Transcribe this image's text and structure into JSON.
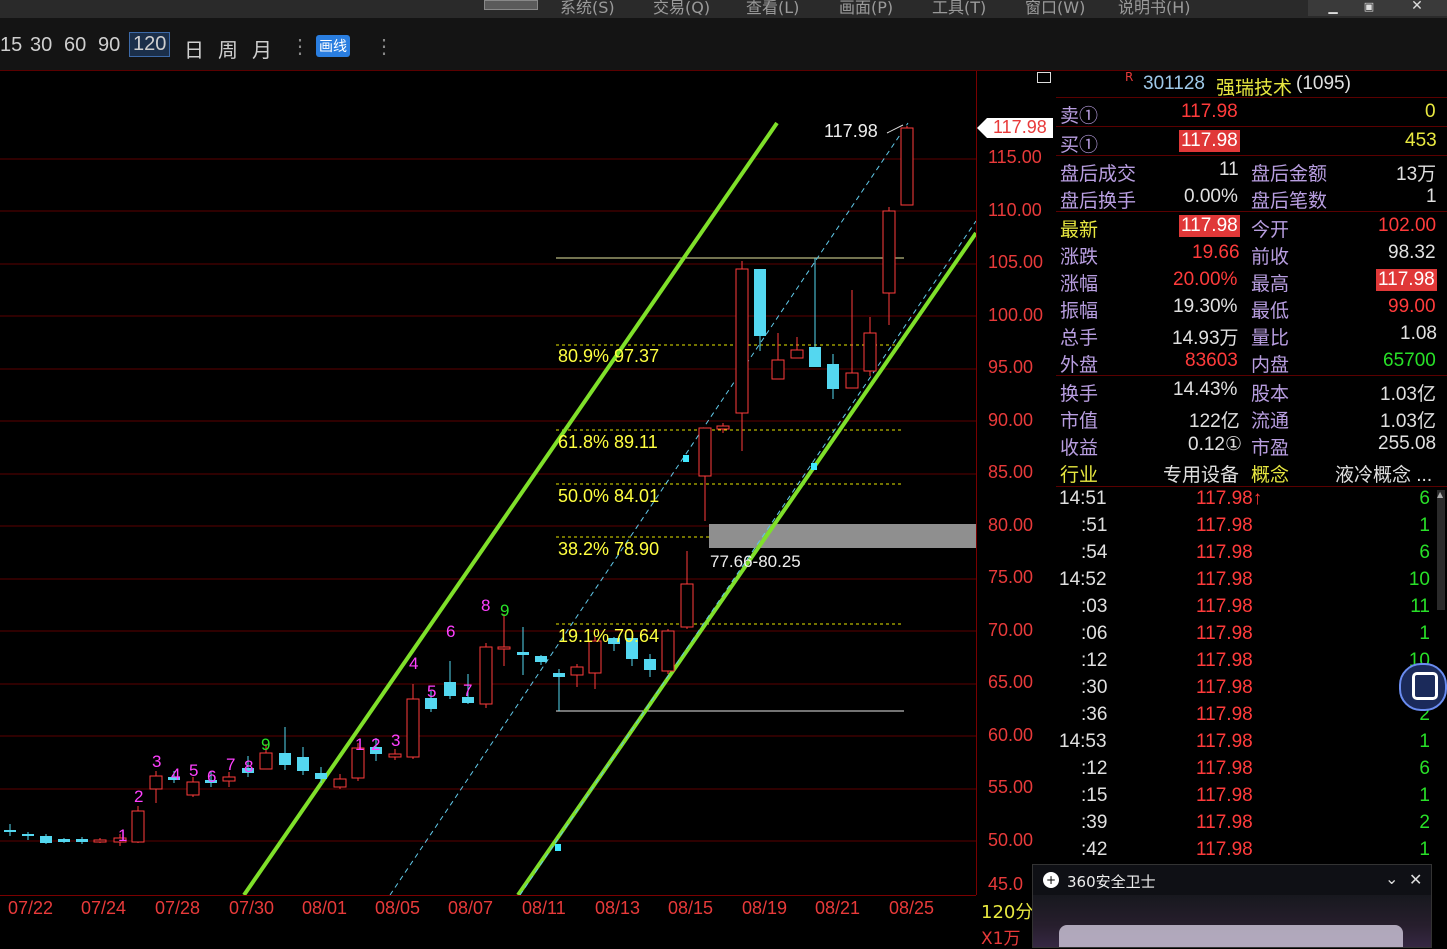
{
  "menu": [
    "系统(S)",
    "交易(Q)",
    "查看(L)",
    "画面(P)",
    "工具(T)",
    "窗口(W)",
    "说明书(H)"
  ],
  "toolbar": {
    "periods": [
      "15",
      "30",
      "60",
      "90"
    ],
    "selected_period": "120",
    "day": "日",
    "week": "周",
    "month": "月",
    "draw_button": "画线"
  },
  "chart": {
    "price_axis": [
      "115.00",
      "110.00",
      "105.00",
      "100.00",
      "95.00",
      "90.00",
      "85.00",
      "80.00",
      "75.00",
      "70.00",
      "65.00",
      "60.00",
      "55.00",
      "50.00",
      "45.0"
    ],
    "date_axis": [
      "07/22",
      "07/24",
      "07/28",
      "07/30",
      "08/01",
      "08/05",
      "08/07",
      "08/11",
      "08/13",
      "08/15",
      "08/19",
      "08/21",
      "08/25"
    ],
    "period_label": "120分",
    "volume_unit": "X1万",
    "last_price_tag": "117.98",
    "high_label": "117.98",
    "fib_levels": [
      {
        "label": "80.9% 97.37"
      },
      {
        "label": "61.8% 89.11"
      },
      {
        "label": "50.0% 84.01"
      },
      {
        "label": "38.2% 78.90"
      },
      {
        "label": "19.1% 70.64"
      }
    ],
    "zone_label": "77.66-80.25",
    "counts": [
      {
        "t": "1",
        "c": "#ff40ff"
      },
      {
        "t": "2",
        "c": "#ff40ff"
      },
      {
        "t": "3",
        "c": "#ff40ff"
      },
      {
        "t": "4",
        "c": "#ff40ff"
      },
      {
        "t": "5",
        "c": "#ff40ff"
      },
      {
        "t": "6",
        "c": "#ff40ff"
      },
      {
        "t": "7",
        "c": "#ff40ff"
      },
      {
        "t": "8",
        "c": "#ff40ff"
      },
      {
        "t": "9",
        "c": "#28e028"
      },
      {
        "t": "1",
        "c": "#ff40ff"
      },
      {
        "t": "2",
        "c": "#ff40ff"
      },
      {
        "t": "3",
        "c": "#ff40ff"
      },
      {
        "t": "4",
        "c": "#ff40ff"
      },
      {
        "t": "5",
        "c": "#ff40ff"
      },
      {
        "t": "6",
        "c": "#ff40ff"
      },
      {
        "t": "7",
        "c": "#ff40ff"
      },
      {
        "t": "8",
        "c": "#ff40ff"
      },
      {
        "t": "9",
        "c": "#28e028"
      }
    ]
  },
  "quote": {
    "marker": "R",
    "code": "301128",
    "name": "强瑞技术",
    "rank": "(1095)",
    "sell_label": "卖①",
    "sell_price": "117.98",
    "sell_vol": "0",
    "buy_label": "买①",
    "buy_price": "117.98",
    "buy_vol": "453",
    "after_vol_label": "盘后成交",
    "after_vol": "11",
    "after_amt_label": "盘后金额",
    "after_amt": "13万",
    "after_turn_label": "盘后换手",
    "after_turn": "0.00%",
    "after_count_label": "盘后笔数",
    "after_count": "1",
    "latest_label": "最新",
    "latest": "117.98",
    "open_label": "今开",
    "open": "102.00",
    "chg_label": "涨跌",
    "chg": "19.66",
    "prev_label": "前收",
    "prev": "98.32",
    "pct_label": "涨幅",
    "pct": "20.00%",
    "high_label": "最高",
    "high": "117.98",
    "amp_label": "振幅",
    "amp": "19.30%",
    "low_label": "最低",
    "low": "99.00",
    "vol_label": "总手",
    "vol": "14.93万",
    "ratio_label": "量比",
    "ratio": "1.08",
    "outer_label": "外盘",
    "outer": "83603",
    "inner_label": "内盘",
    "inner": "65700",
    "turn_label": "换手",
    "turn": "14.43%",
    "shares_label": "股本",
    "shares": "1.03亿",
    "mcap_label": "市值",
    "mcap": "122亿",
    "float_label": "流通",
    "float": "1.03亿",
    "eps_label": "收益",
    "eps": "0.12①",
    "pe_label": "市盈",
    "pe": "255.08",
    "ind_label": "行业",
    "ind": "专用设备",
    "concept_label": "概念",
    "concept": "液冷概念 ..."
  },
  "ticks": [
    {
      "t": "14:51",
      "p": "117.98↑",
      "v": "6"
    },
    {
      "t": ":51",
      "p": "117.98",
      "v": "1"
    },
    {
      "t": ":54",
      "p": "117.98",
      "v": "6"
    },
    {
      "t": "14:52",
      "p": "117.98",
      "v": "10"
    },
    {
      "t": ":03",
      "p": "117.98",
      "v": "11"
    },
    {
      "t": ":06",
      "p": "117.98",
      "v": "1"
    },
    {
      "t": ":12",
      "p": "117.98",
      "v": "10"
    },
    {
      "t": ":30",
      "p": "117.98",
      "v": ""
    },
    {
      "t": ":36",
      "p": "117.98",
      "v": "2"
    },
    {
      "t": "14:53",
      "p": "117.98",
      "v": "1"
    },
    {
      "t": ":12",
      "p": "117.98",
      "v": "6"
    },
    {
      "t": ":15",
      "p": "117.98",
      "v": "1"
    },
    {
      "t": ":39",
      "p": "117.98",
      "v": "2"
    },
    {
      "t": ":42",
      "p": "117.98",
      "v": "1"
    }
  ],
  "popup": {
    "title": "360安全卫士"
  }
}
